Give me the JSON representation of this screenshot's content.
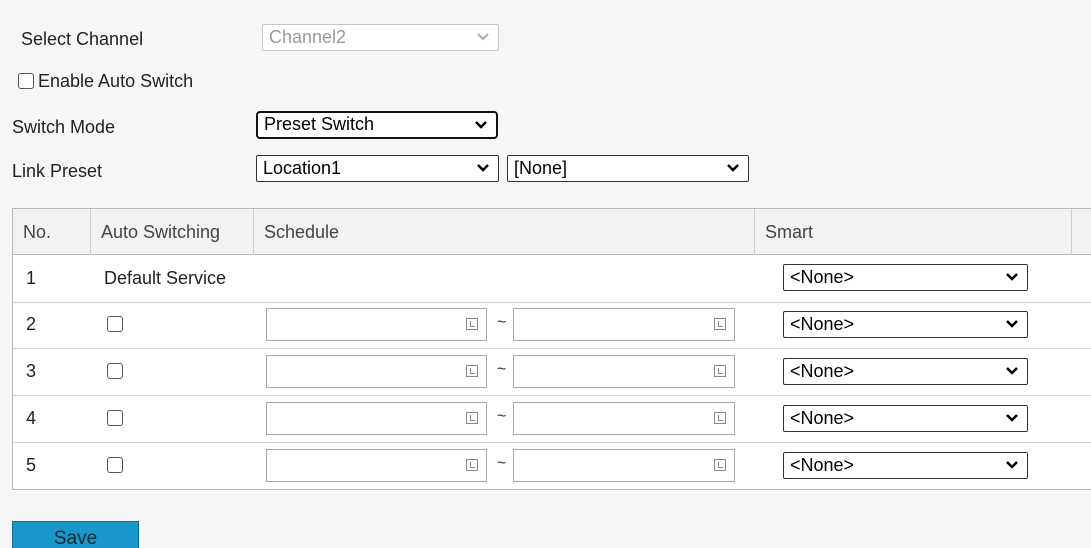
{
  "form": {
    "select_channel_label": "Select Channel",
    "channel_value": "Channel2",
    "enable_auto_switch_label": "Enable Auto Switch",
    "switch_mode_label": "Switch Mode",
    "switch_mode_value": "Preset Switch",
    "link_preset_label": "Link Preset",
    "link_preset_value": "Location1",
    "link_preset_secondary_value": "[None]"
  },
  "table": {
    "headers": [
      "No.",
      "Auto Switching",
      "Schedule",
      "Smart"
    ],
    "rows": [
      {
        "no": "1",
        "auto_switching": "Default Service",
        "smart": "<None>"
      },
      {
        "no": "2",
        "smart": "<None>",
        "tilde": "~"
      },
      {
        "no": "3",
        "smart": "<None>",
        "tilde": "~"
      },
      {
        "no": "4",
        "smart": "<None>",
        "tilde": "~"
      },
      {
        "no": "5",
        "smart": "<None>",
        "tilde": "~"
      }
    ]
  },
  "buttons": {
    "save_label": "Save"
  },
  "colors": {
    "save_button": "#1a96c8",
    "page_background": "#f5f6f7"
  }
}
